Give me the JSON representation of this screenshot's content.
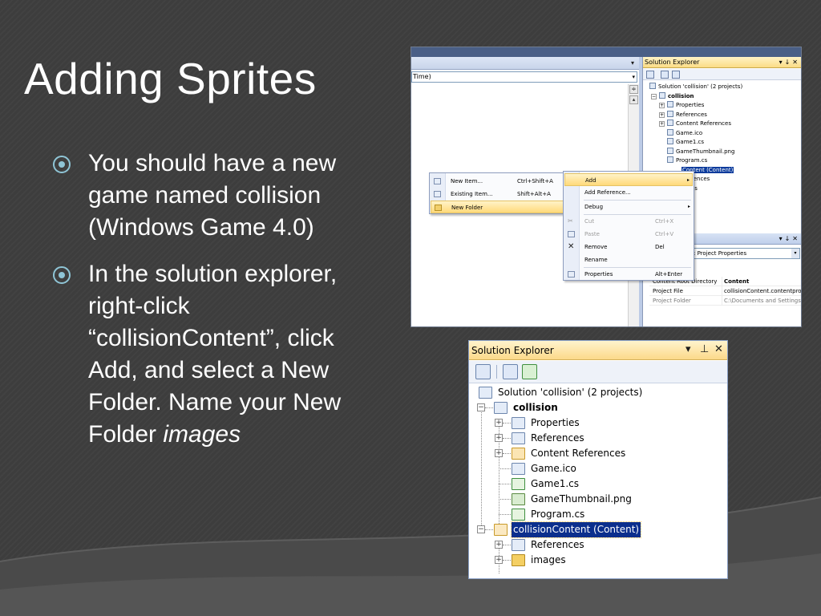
{
  "slide": {
    "title": "Adding Sprites",
    "bullets": [
      {
        "text": "You should have a new game named collision (Windows Game 4.0)"
      },
      {
        "text": "In the solution explorer, right-click “collisionContent”, click Add, and select a New Folder.  Name your New Folder ",
        "emphasis": "images"
      }
    ],
    "colors": {
      "background": "#3c3c3c",
      "text": "#ffffff",
      "bullet_accent": "#8fc5d6"
    }
  },
  "screenshot1": {
    "editor_combo_text": "Time)",
    "solution_explorer": {
      "title": "Solution Explorer",
      "buttons": [
        "▾",
        "↓",
        "✕"
      ],
      "tree": [
        {
          "label": "Solution 'collision' (2 projects)",
          "indent": 0,
          "icon": "solution-icon"
        },
        {
          "label": "collision",
          "indent": 1,
          "expander": "−",
          "icon": "project-icon",
          "bold": true
        },
        {
          "label": "Properties",
          "indent": 2,
          "expander": "+",
          "icon": "properties-icon"
        },
        {
          "label": "References",
          "indent": 2,
          "expander": "+",
          "icon": "references-icon"
        },
        {
          "label": "Content References",
          "indent": 2,
          "expander": "+",
          "icon": "content-references-icon"
        },
        {
          "label": "Game.ico",
          "indent": 2,
          "icon": "ico-file-icon"
        },
        {
          "label": "Game1.cs",
          "indent": 2,
          "icon": "cs-file-icon"
        },
        {
          "label": "GameThumbnail.png",
          "indent": 2,
          "icon": "png-file-icon"
        },
        {
          "label": "Program.cs",
          "indent": 2,
          "icon": "cs-file-icon"
        },
        {
          "label": "Content (Content)",
          "indent": 1,
          "icon": "content-project-icon",
          "selected": true
        },
        {
          "label": "rences",
          "indent": 2
        },
        {
          "label": "es",
          "indent": 2
        }
      ]
    },
    "properties": {
      "title_buttons": [
        "▾",
        "↓",
        "✕"
      ],
      "combo": ": Project Properties",
      "rows": [
        {
          "key": "Content Root Directory",
          "value": "Content",
          "bold": true
        },
        {
          "key": "Project File",
          "value": "collisionContent.contentproj"
        },
        {
          "key": "Project Folder",
          "value": "C:\\Documents and Settings\\",
          "dim": true
        }
      ]
    },
    "menu_add_sub": [
      {
        "label": "New Item...",
        "shortcut": "Ctrl+Shift+A",
        "icon": "new-item-icon"
      },
      {
        "label": "Existing Item...",
        "shortcut": "Shift+Alt+A",
        "icon": "existing-item-icon"
      },
      {
        "label": "New Folder",
        "shortcut": "",
        "icon": "folder-icon",
        "highlighted": true
      }
    ],
    "menu_context": [
      {
        "label": "Add",
        "shortcut": "",
        "submenu": true,
        "highlighted": true
      },
      {
        "label": "Add Reference...",
        "shortcut": ""
      },
      {
        "label": "Debug",
        "shortcut": "",
        "submenu": true
      },
      {
        "label": "Cut",
        "shortcut": "Ctrl+X",
        "disabled": true,
        "icon": "cut-icon"
      },
      {
        "label": "Paste",
        "shortcut": "Ctrl+V",
        "disabled": true,
        "icon": "paste-icon"
      },
      {
        "label": "Remove",
        "shortcut": "Del",
        "icon": "remove-icon"
      },
      {
        "label": "Rename",
        "shortcut": ""
      },
      {
        "label": "Properties",
        "shortcut": "Alt+Enter",
        "icon": "properties-icon"
      }
    ]
  },
  "screenshot2": {
    "title": "Solution Explorer",
    "buttons": [
      "▾",
      "X",
      "✕"
    ],
    "tree": [
      {
        "label": "Solution 'collision' (2 projects)",
        "icon": "solution-icon"
      },
      {
        "label": "collision",
        "expander": "−",
        "icon": "project-icon",
        "bold": true
      },
      {
        "label": "Properties",
        "expander": "+",
        "icon": "properties-icon"
      },
      {
        "label": "References",
        "expander": "+",
        "icon": "references-icon"
      },
      {
        "label": "Content References",
        "expander": "+",
        "icon": "content-references-icon"
      },
      {
        "label": "Game.ico",
        "icon": "ico-file-icon"
      },
      {
        "label": "Game1.cs",
        "icon": "cs-file-icon"
      },
      {
        "label": "GameThumbnail.png",
        "icon": "png-file-icon"
      },
      {
        "label": "Program.cs",
        "icon": "cs-file-icon"
      },
      {
        "label": "collisionContent (Content)",
        "expander": "−",
        "icon": "content-project-icon",
        "selected": true
      },
      {
        "label": "References",
        "expander": "+",
        "icon": "references-icon"
      },
      {
        "label": "images",
        "expander": "+",
        "icon": "folder-icon"
      }
    ]
  }
}
